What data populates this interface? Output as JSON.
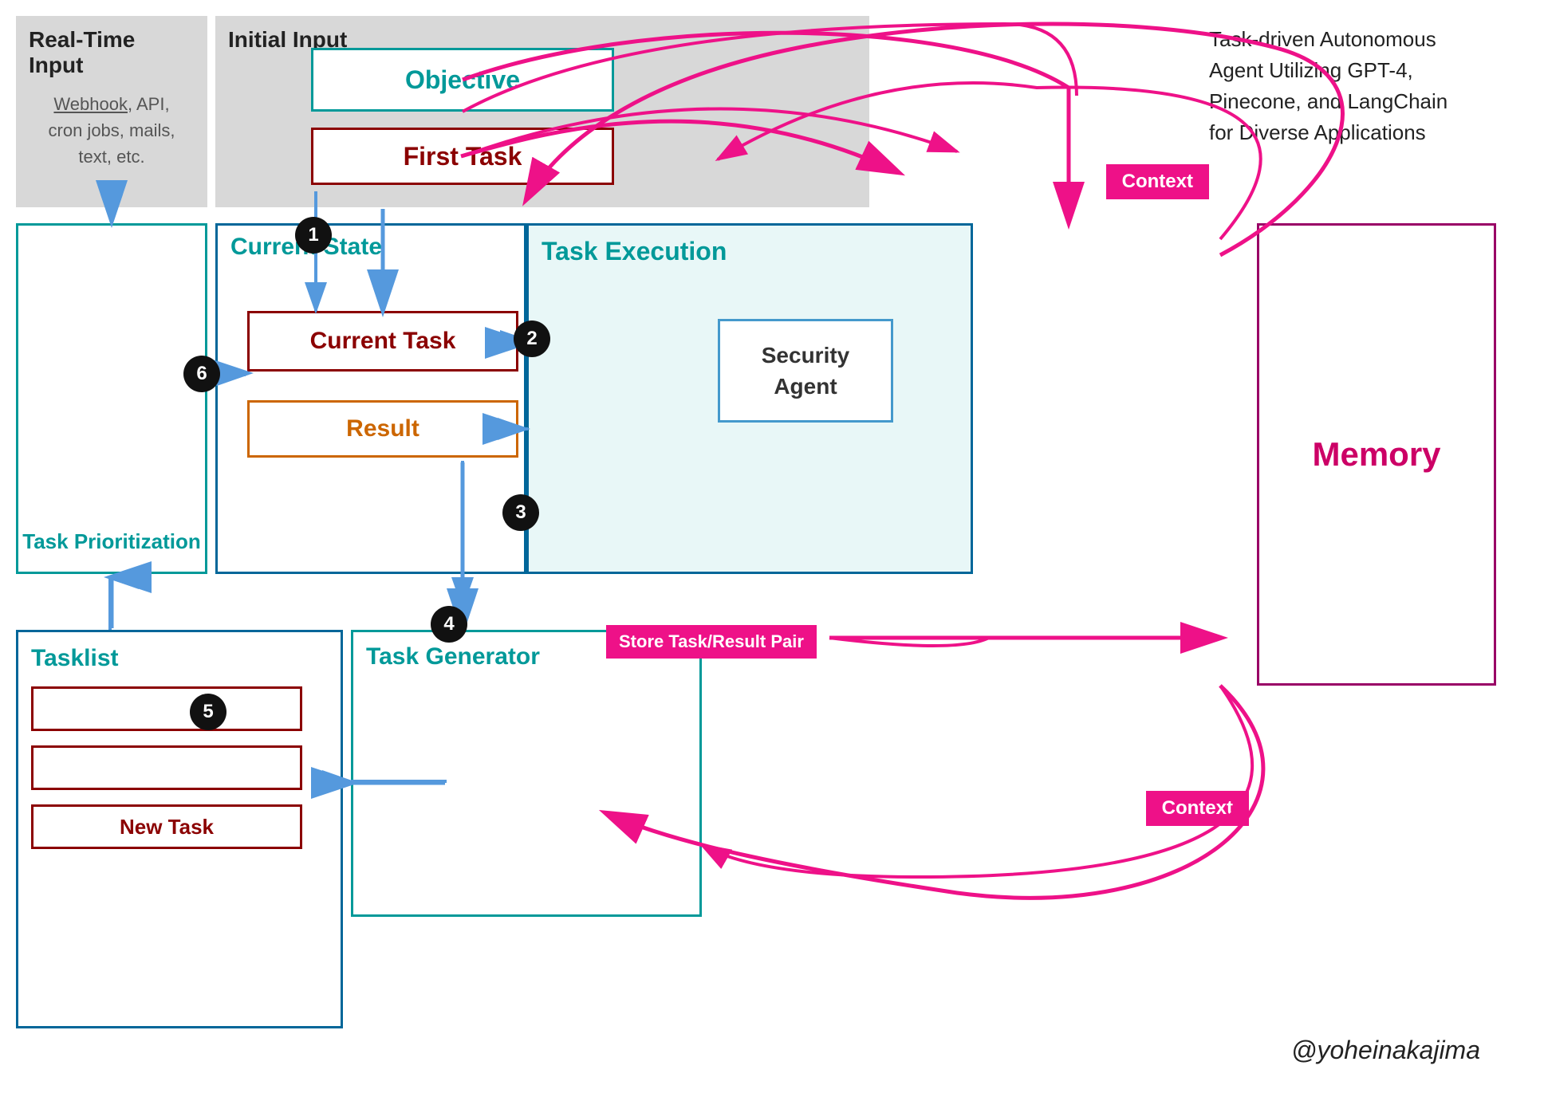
{
  "title": "Task-driven Autonomous Agent",
  "description": "Task-driven Autonomous\nAgent Utilizing GPT-4,\nPinecone, and LangChain\nfor Diverse Applications",
  "real_time_input": {
    "title": "Real-Time Input",
    "content": "Webhook, API,\ncron jobs, mails,\ntext, etc."
  },
  "initial_input": {
    "title": "Initial Input"
  },
  "objective": {
    "label": "Objective"
  },
  "first_task": {
    "label": "First Task"
  },
  "current_state": {
    "label": "Current State"
  },
  "current_task": {
    "label": "Current Task"
  },
  "result": {
    "label": "Result"
  },
  "task_prioritization": {
    "label": "Task Prioritization"
  },
  "task_execution": {
    "label": "Task Execution"
  },
  "security_agent": {
    "label": "Security\nAgent"
  },
  "memory": {
    "label": "Memory"
  },
  "tasklist": {
    "title": "Tasklist",
    "new_task": "New Task"
  },
  "task_generator": {
    "label": "Task Generator"
  },
  "context_top": "Context",
  "context_bottom": "Context",
  "store_task": "Store Task/Result Pair",
  "steps": [
    "1",
    "2",
    "3",
    "4",
    "5",
    "6"
  ],
  "signature": "@yoheinakajima"
}
